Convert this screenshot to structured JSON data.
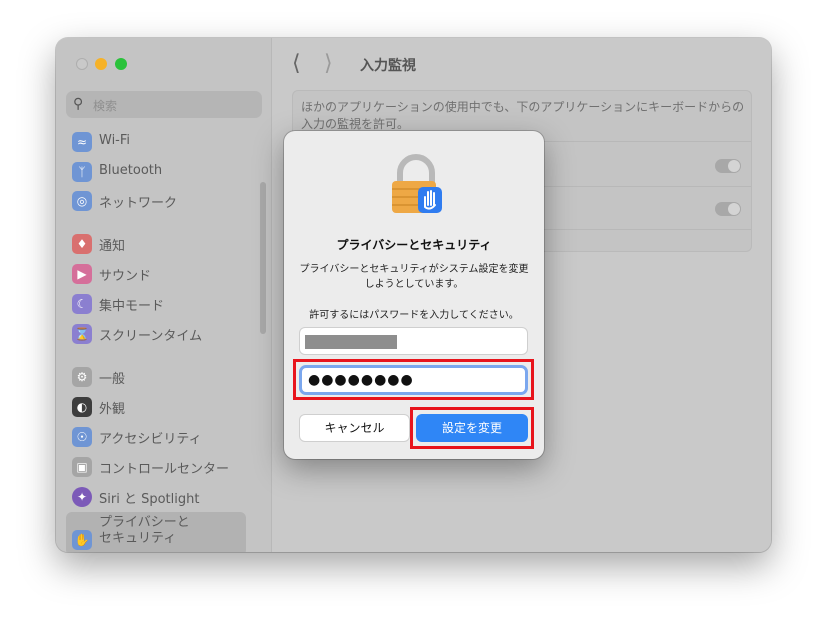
{
  "sidebar": {
    "search_placeholder": "検索",
    "items": [
      {
        "label": "Wi-Fi",
        "icon": "wifi-icon",
        "color": "#6f95d4"
      },
      {
        "label": "Bluetooth",
        "icon": "bluetooth-icon",
        "color": "#6f95d4"
      },
      {
        "label": "ネットワーク",
        "icon": "globe-icon",
        "color": "#6f95d4"
      },
      {
        "label": "通知",
        "icon": "bell-icon",
        "color": "#d9706f"
      },
      {
        "label": "サウンド",
        "icon": "speaker-icon",
        "color": "#d56f9a"
      },
      {
        "label": "集中モード",
        "icon": "moon-icon",
        "color": "#8b7fd0"
      },
      {
        "label": "スクリーンタイム",
        "icon": "hourglass-icon",
        "color": "#8b7fd0"
      },
      {
        "label": "一般",
        "icon": "gear-icon",
        "color": "#a5a5a5"
      },
      {
        "label": "外観",
        "icon": "appearance-icon",
        "color": "#3d3d3d"
      },
      {
        "label": "アクセシビリティ",
        "icon": "accessibility-icon",
        "color": "#6f95d4"
      },
      {
        "label": "コントロールセンター",
        "icon": "toggles-icon",
        "color": "#a5a5a5"
      },
      {
        "label": "Siri と Spotlight",
        "icon": "siri-icon",
        "color": "#7c5ab8"
      },
      {
        "label": "プライバシーと\nセキュリティ",
        "icon": "hand-icon",
        "color": "#6f95d4"
      }
    ]
  },
  "main": {
    "title": "入力監視",
    "description": "ほかのアプリケーションの使用中でも、下のアプリケーションにキーボードからの入力の監視を許可。"
  },
  "dialog": {
    "title": "プライバシーとセキュリティ",
    "message": "プライバシーとセキュリティがシステム設定を変更しようとしています。",
    "prompt": "許可するにはパスワードを入力してください。",
    "password_masked": "●●●●●●●●",
    "cancel_label": "キャンセル",
    "confirm_label": "設定を変更"
  }
}
